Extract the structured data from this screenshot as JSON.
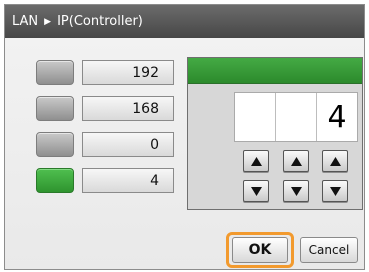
{
  "title": {
    "section": "LAN",
    "separator_icon": "breadcrumb-arrow-icon",
    "page": "IP(Controller)"
  },
  "octets": [
    {
      "value": "192",
      "selected": false
    },
    {
      "value": "168",
      "selected": false
    },
    {
      "value": "0",
      "selected": false
    },
    {
      "value": "4",
      "selected": true
    }
  ],
  "editor": {
    "digits": [
      "",
      "",
      "4"
    ],
    "up_icon": "triangle-up-icon",
    "down_icon": "triangle-down-icon"
  },
  "buttons": {
    "ok_label": "OK",
    "cancel_label": "Cancel"
  },
  "colors": {
    "title_bar": "#474747",
    "selected_green": "#2f942f",
    "ok_focus_ring": "#f29a2e"
  }
}
